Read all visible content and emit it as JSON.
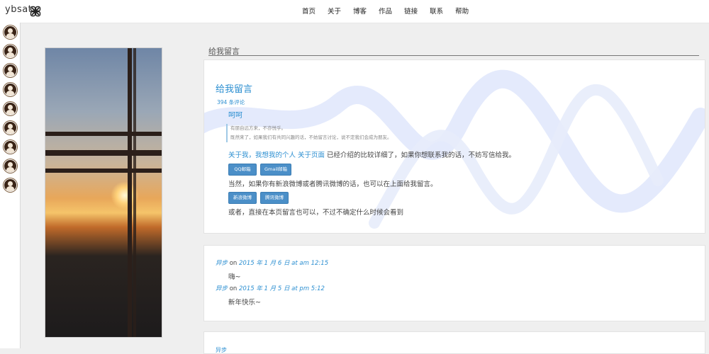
{
  "header": {
    "logo_text": "ybsat",
    "logo_icon": "knot-logo-icon",
    "nav": [
      "首页",
      "关于",
      "博客",
      "作品",
      "链接",
      "联系",
      "帮助"
    ]
  },
  "sidebar": {
    "avatar_icon": "user-avatar-icon",
    "avatar_count": 9
  },
  "section": {
    "title": "给我留言"
  },
  "post": {
    "title": "给我留言",
    "comment_count": "394 条评论",
    "greeting": "呵呵",
    "quote_line1": "有朋自远方来，不亦悦乎。",
    "quote_line2": "既然来了，如果我们有共同兴趣的话，不妨留言讨论，说不定我们会成为朋友。",
    "para1_link": "关于我，我想我的个人 关于页面",
    "para1_text": " 已经介绍的比较详细了，如果你想联系我的话，不妨写信给我。",
    "btn_qq": "QQ邮箱",
    "btn_gmail": "Gmail邮箱",
    "para2": "当然，如果你有新浪微博或者腾讯微博的话，也可以在上面给我留言。",
    "btn_sina": "新浪微博",
    "btn_tencent": "腾讯微博",
    "para3": "或者，直接在本页留言也可以，不过不确定什么时候会看到"
  },
  "comments": [
    {
      "author": "异步",
      "on": "on",
      "date": "2015 年 1 月 6 日 at am 12:15",
      "text": "嗨~"
    },
    {
      "author": "异步",
      "on": "on",
      "date": "2015 年 1 月 5 日 at pm 5:12",
      "text": "新年快乐~"
    }
  ],
  "next_card": {
    "peek": "异步"
  },
  "colors": {
    "accent": "#2c8fd1",
    "button": "#4b8fc8",
    "background": "#efefef"
  }
}
